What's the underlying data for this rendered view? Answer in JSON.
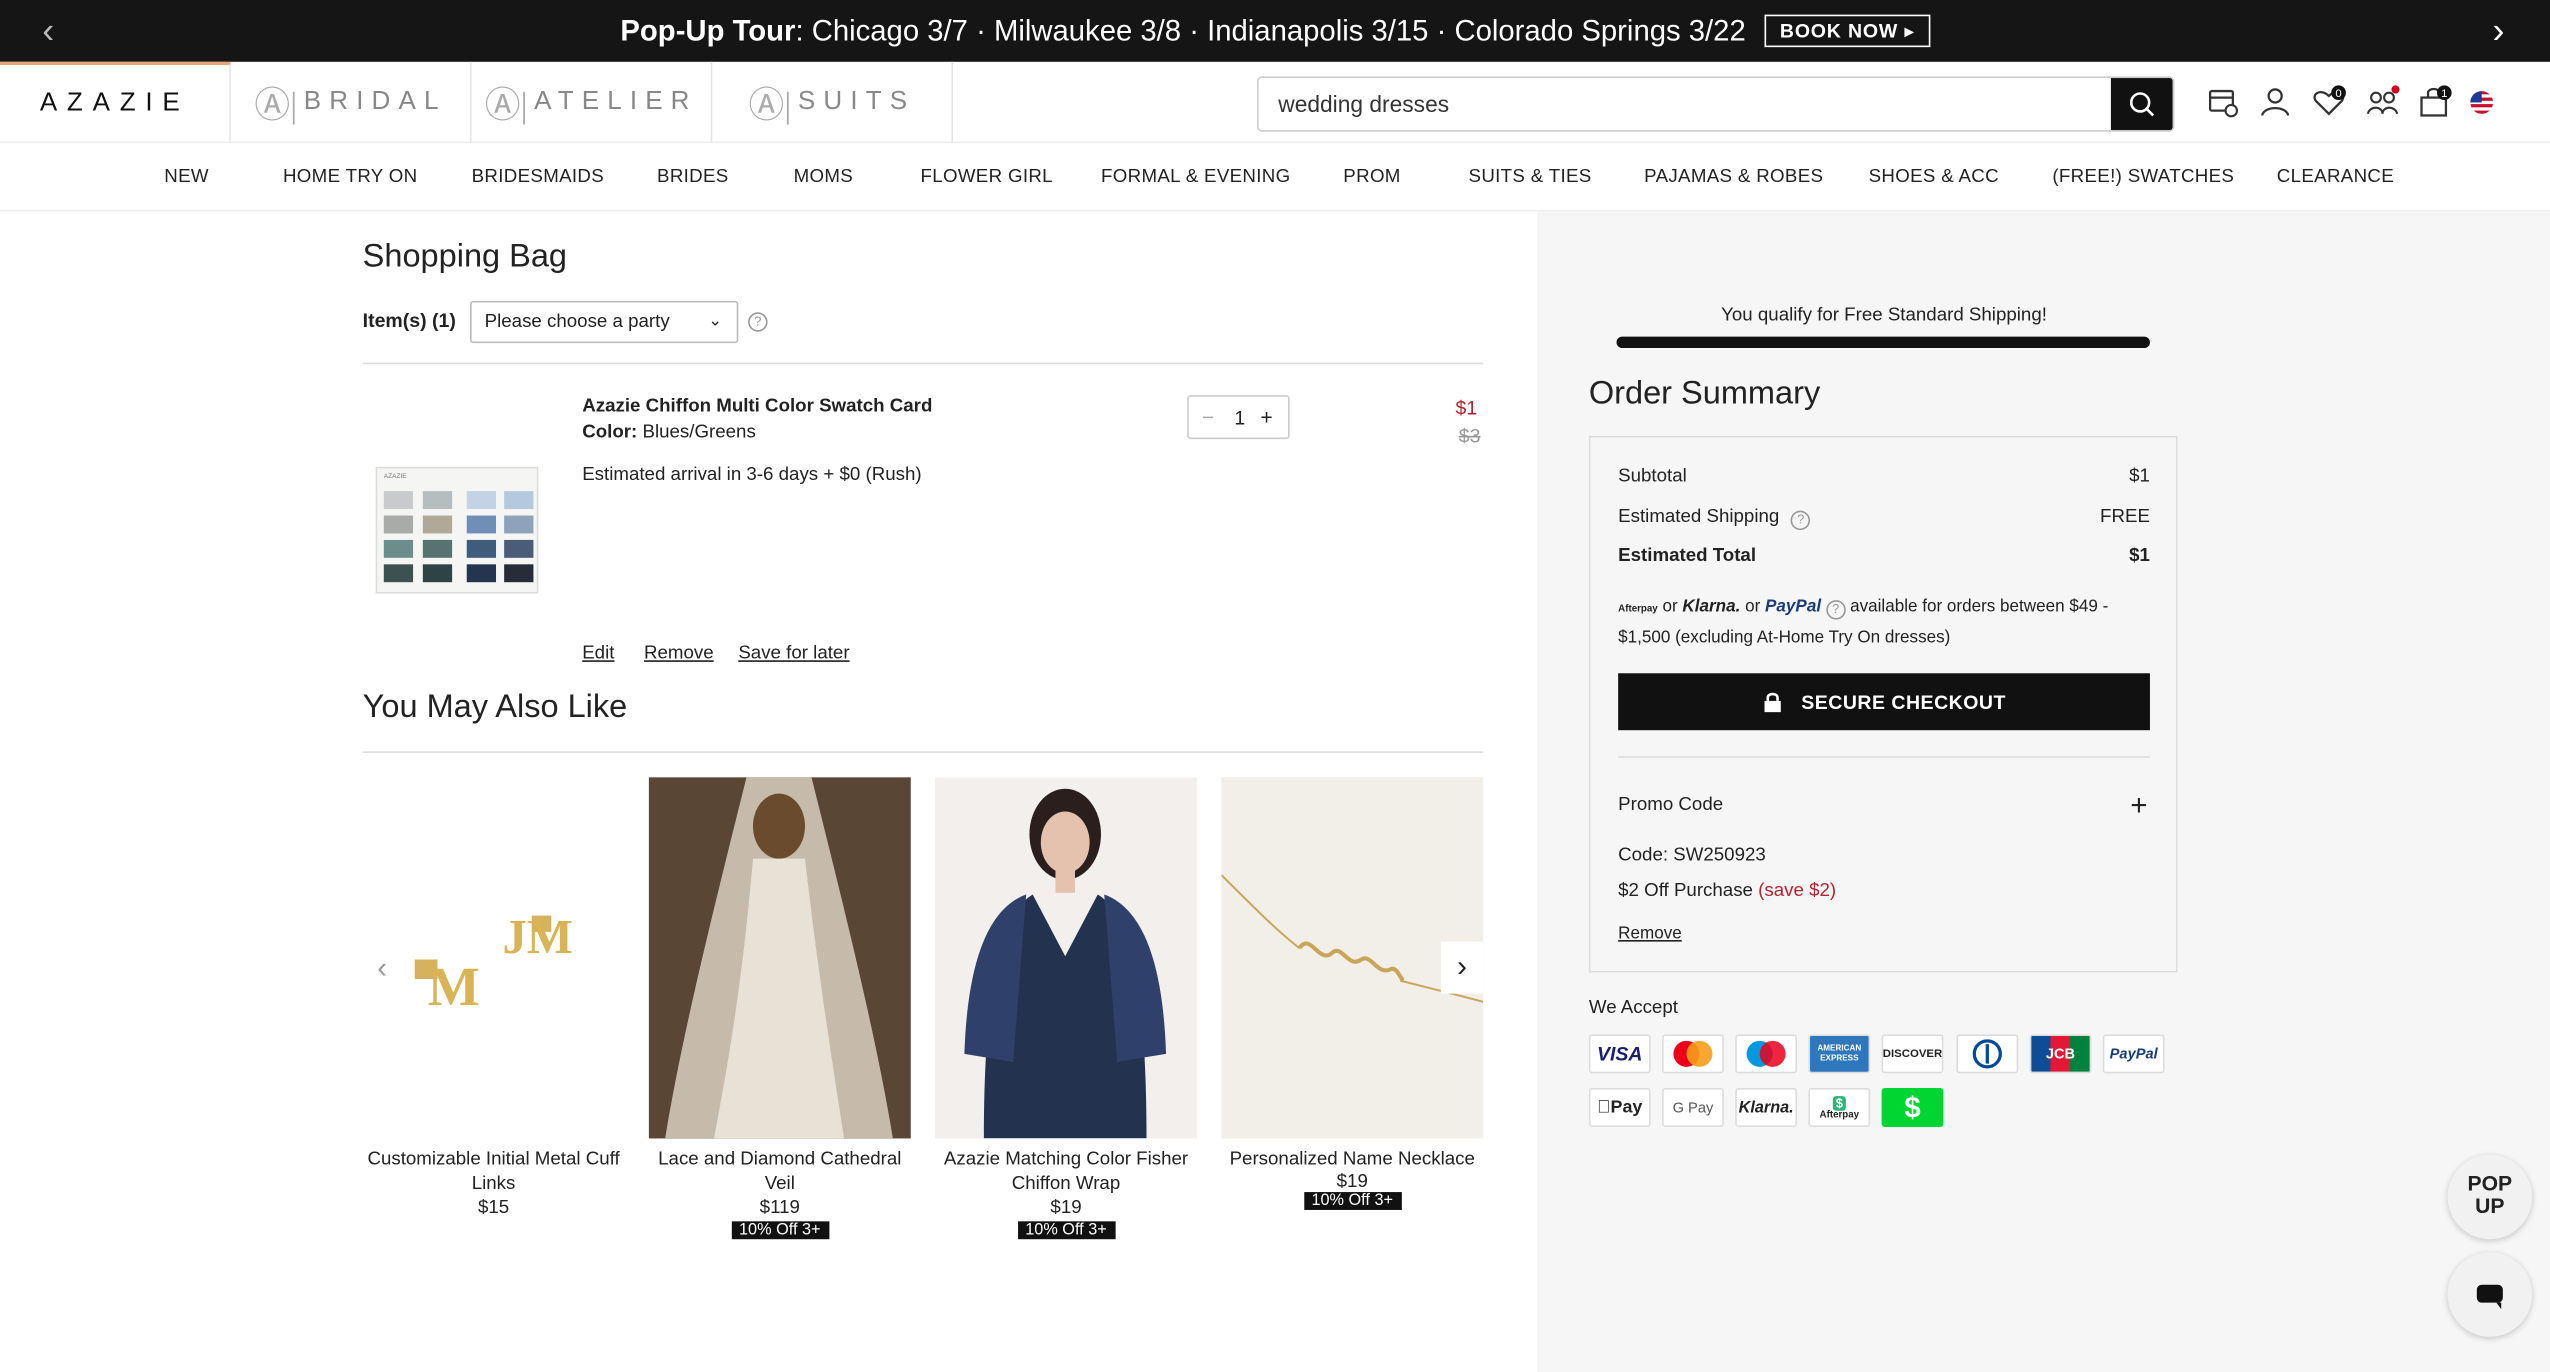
{
  "promo_bar": {
    "title": "Pop-Up Tour",
    "cities": ": Chicago 3/7 · Milwaukee 3/8 · Indianapolis 3/15 · Colorado Springs 3/22",
    "book": "BOOK NOW ▸",
    "prev": "‹",
    "next": "›"
  },
  "header": {
    "brand": "AZAZIE",
    "tabs": [
      "BRIDAL",
      "ATELIER",
      "SUITS"
    ],
    "search_value": "wedding dresses",
    "wishlist_count": "0",
    "cart_count": "1"
  },
  "nav": [
    "NEW",
    "HOME TRY ON",
    "BRIDESMAIDS",
    "BRIDES",
    "MOMS",
    "FLOWER GIRL",
    "FORMAL & EVENING",
    "PROM",
    "SUITS & TIES",
    "PAJAMAS & ROBES",
    "SHOES & ACC",
    "(FREE!) SWATCHES",
    "CLEARANCE"
  ],
  "bag": {
    "title": "Shopping Bag",
    "items_label": "Item(s) (1)",
    "party_select": "Please choose a party",
    "item": {
      "name": "Azazie Chiffon Multi Color Swatch Card",
      "color_label": "Color:",
      "color_value": "Blues/Greens",
      "arrival": "Estimated arrival in 3-6 days + $0 (Rush)",
      "qty": "1",
      "price": "$1",
      "old_price": "$3",
      "thumb_label": "AZAZIE"
    },
    "links": {
      "edit": "Edit",
      "remove": "Remove",
      "save": "Save for later"
    }
  },
  "also_like": {
    "title": "You May Also Like",
    "products": [
      {
        "name": "Customizable Initial Metal Cuff Links",
        "price": "$15",
        "badge": ""
      },
      {
        "name": "Lace and Diamond Cathedral Veil",
        "price": "$119",
        "badge": "10% Off 3+"
      },
      {
        "name": "Azazie Matching Color Fisher Chiffon Wrap",
        "price": "$19",
        "badge": "10% Off 3+"
      },
      {
        "name": "Personalized Name Necklace",
        "price": "$19",
        "badge": "10% Off 3+"
      }
    ]
  },
  "summary": {
    "shipping_msg": "You qualify for Free Standard Shipping!",
    "title": "Order Summary",
    "subtotal_label": "Subtotal",
    "subtotal": "$1",
    "shipping_label": "Estimated Shipping",
    "shipping": "FREE",
    "total_label": "Estimated Total",
    "total": "$1",
    "bnpl_afterpay": "Afterpay",
    "bnpl_or1": "or",
    "bnpl_klarna": "Klarna.",
    "bnpl_or2": "or",
    "bnpl_paypal": "PayPal",
    "bnpl_text": "available for orders between $49 - $1,500 (excluding At-Home Try On dresses)",
    "checkout": "SECURE CHECKOUT",
    "promo_label": "Promo Code",
    "code": "Code: SW250923",
    "discount_text": "$2 Off Purchase",
    "discount_save": "(save $2)",
    "remove": "Remove",
    "accept_label": "We Accept"
  },
  "payments": {
    "visa": "VISA",
    "discover": "DISCOVER",
    "jcb": "JCB",
    "paypal": "PayPal",
    "amex": "AMERICAN EXPRESS",
    "applepay": "Pay",
    "gpay": "G Pay",
    "klarna": "Klarna.",
    "afterpay": "Afterpay"
  },
  "float": {
    "popup_line1": "POP",
    "popup_line2": "UP"
  },
  "colors": {
    "accent": "#b8222f",
    "dark": "#111111",
    "panel": "#f6f6f6"
  }
}
